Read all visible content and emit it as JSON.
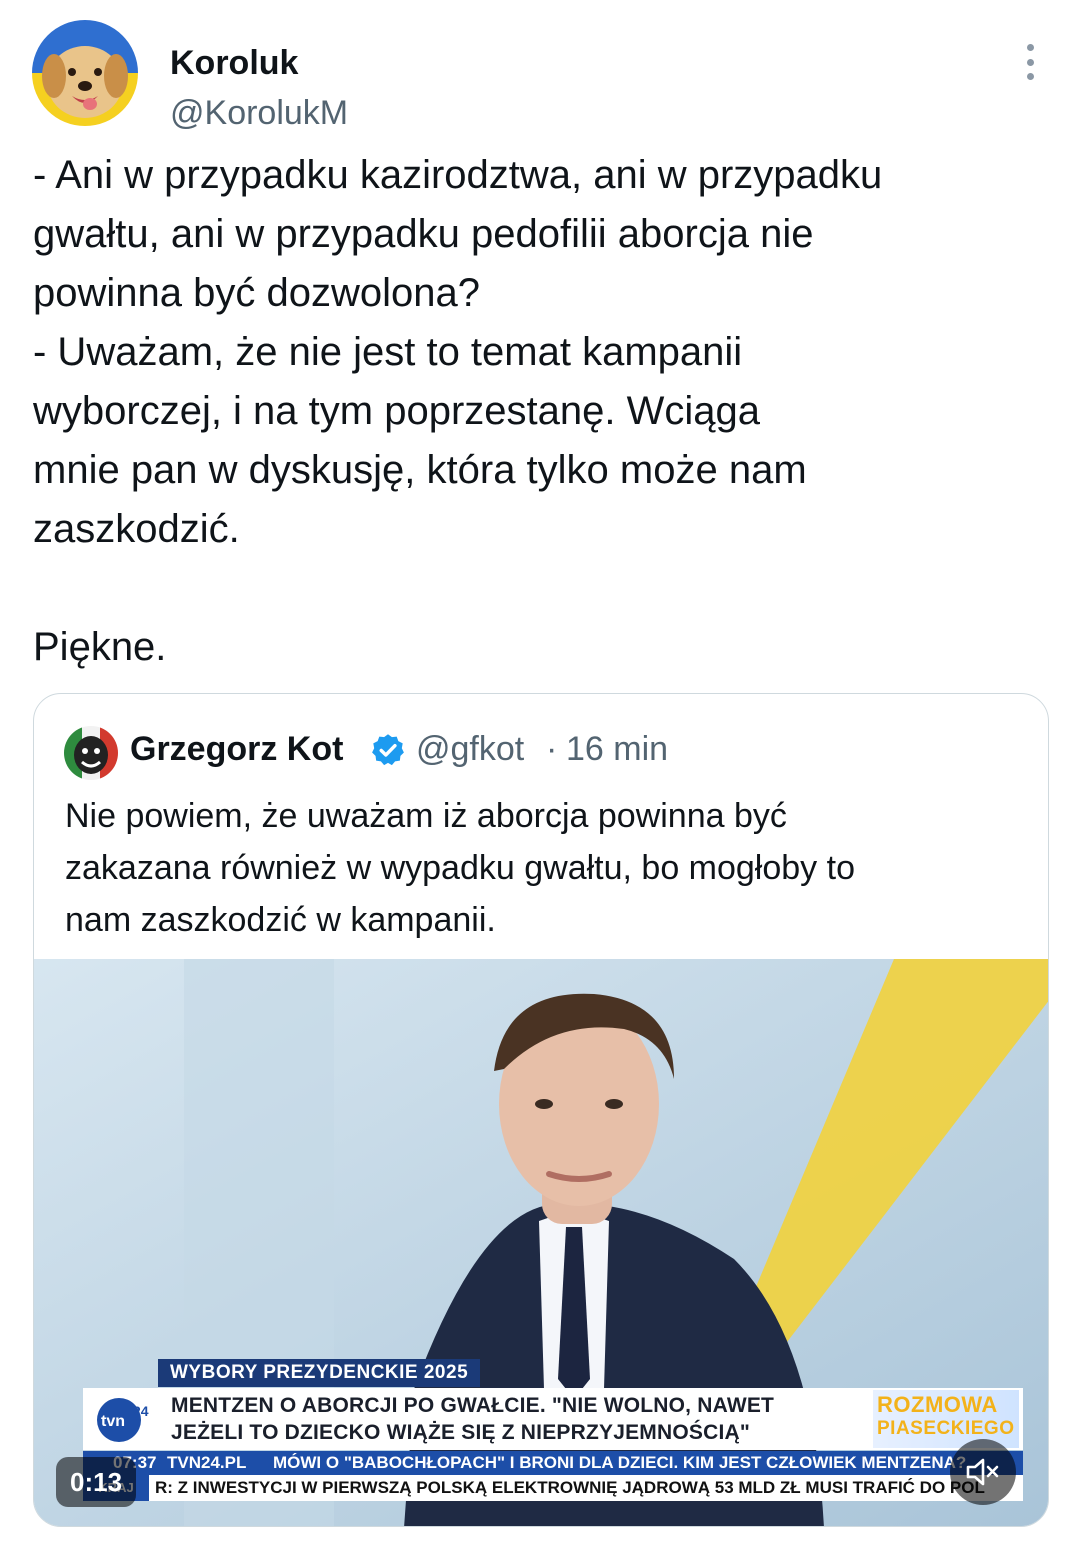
{
  "author": {
    "name": "Koroluk",
    "handle": "@KorolukM"
  },
  "tweet": {
    "lines": [
      "- Ani w przypadku kazirodztwa, ani w przypadku",
      "gwałtu, ani w przypadku pedofilii aborcja nie",
      "powinna być dozwolona?",
      "- Uważam, że nie jest to temat kampanii",
      "wyborczej, i na tym poprzestanę. Wciąga",
      "mnie pan w dyskusję, która tylko może nam",
      "zaszkodzić."
    ],
    "closing": "Piękne."
  },
  "quoted": {
    "name": "Grzegorz Kot",
    "handle": "@gfkot",
    "separator": "·",
    "time": "16 min",
    "lines": [
      "Nie powiem, że uważam iż aborcja powinna być",
      "zakazana również w wypadku gwałtu, bo mogłoby to",
      "nam zaszkodzić w kampanii."
    ]
  },
  "video": {
    "elapsed": "0:13",
    "chyron_top": "WYBORY PREZYDENCKIE 2025",
    "headline_line1": "MENTZEN O ABORCJI PO GWAŁCIE. \"NIE WOLNO, NAWET",
    "headline_line2": "JEŻELI TO DZIECKO WIĄŻE SIĘ Z NIEPRZYJEMNOŚCIĄ\"",
    "show_line1": "ROZMOWA",
    "show_line2": "PIASECKIEGO",
    "clock": "07:37",
    "site": "TVN24.PL",
    "ticker1": "MÓWI O \"BABOCHŁOPACH\" I BRONI DLA DZIECI. KIM JEST CZŁOWIEK MENTZENA?",
    "section": "KRAJ",
    "ticker2": "R: Z INWESTYCJI W PIERWSZĄ POLSKĄ ELEKTROWNIĘ JĄDROWĄ 53 MLD ZŁ MUSI TRAFIĆ DO POL"
  },
  "icons": {
    "more": "more-vertical-icon",
    "verified": "verified-badge-icon",
    "mute": "speaker-muted-icon"
  },
  "colors": {
    "text": "#0f1419",
    "secondary": "#536471",
    "verified": "#1d9bf0",
    "border": "#cfd9de"
  }
}
